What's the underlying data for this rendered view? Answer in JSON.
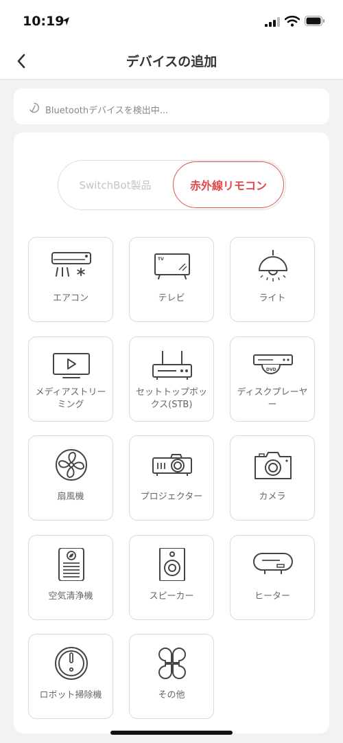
{
  "status_bar": {
    "time": "10:19"
  },
  "nav": {
    "title": "デバイスの追加"
  },
  "scan": {
    "text": "Bluetoothデバイスを検出中..."
  },
  "segment": {
    "left_label": "SwitchBot製品",
    "right_label": "赤外線リモコン"
  },
  "devices": [
    {
      "label": "エアコン",
      "icon": "air-conditioner-icon"
    },
    {
      "label": "テレビ",
      "icon": "tv-icon"
    },
    {
      "label": "ライト",
      "icon": "light-icon"
    },
    {
      "label": "メディアストリーミング",
      "icon": "media-streaming-icon"
    },
    {
      "label": "セットトップボックス(STB)",
      "icon": "set-top-box-icon"
    },
    {
      "label": "ディスクプレーヤー",
      "icon": "disc-player-icon"
    },
    {
      "label": "扇風機",
      "icon": "fan-icon"
    },
    {
      "label": "プロジェクター",
      "icon": "projector-icon"
    },
    {
      "label": "カメラ",
      "icon": "camera-icon"
    },
    {
      "label": "空気清浄機",
      "icon": "air-purifier-icon"
    },
    {
      "label": "スピーカー",
      "icon": "speaker-icon"
    },
    {
      "label": "ヒーター",
      "icon": "heater-icon"
    },
    {
      "label": "ロボット掃除機",
      "icon": "robot-vacuum-icon"
    },
    {
      "label": "その他",
      "icon": "others-icon"
    }
  ]
}
